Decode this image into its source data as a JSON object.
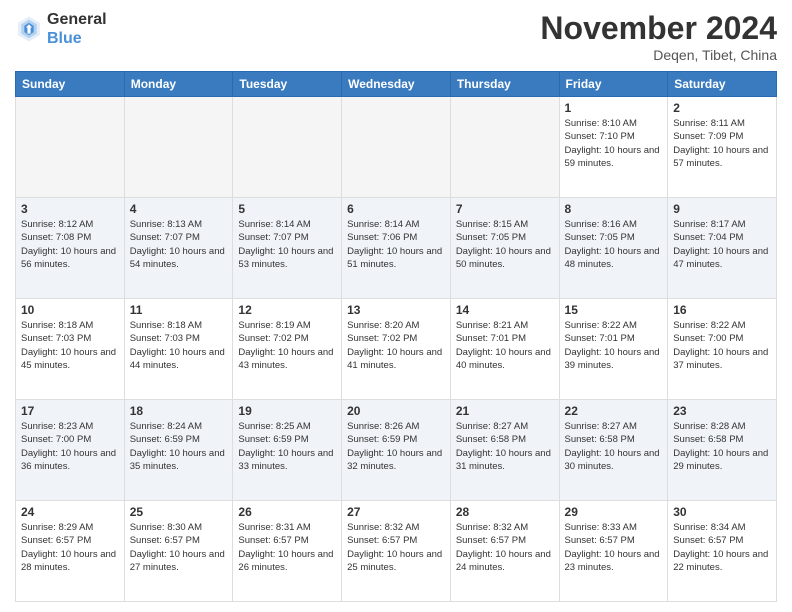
{
  "logo": {
    "line1": "General",
    "line2": "Blue"
  },
  "title": "November 2024",
  "location": "Deqen, Tibet, China",
  "weekdays": [
    "Sunday",
    "Monday",
    "Tuesday",
    "Wednesday",
    "Thursday",
    "Friday",
    "Saturday"
  ],
  "weeks": [
    [
      {
        "day": "",
        "info": ""
      },
      {
        "day": "",
        "info": ""
      },
      {
        "day": "",
        "info": ""
      },
      {
        "day": "",
        "info": ""
      },
      {
        "day": "",
        "info": ""
      },
      {
        "day": "1",
        "info": "Sunrise: 8:10 AM\nSunset: 7:10 PM\nDaylight: 10 hours and 59 minutes."
      },
      {
        "day": "2",
        "info": "Sunrise: 8:11 AM\nSunset: 7:09 PM\nDaylight: 10 hours and 57 minutes."
      }
    ],
    [
      {
        "day": "3",
        "info": "Sunrise: 8:12 AM\nSunset: 7:08 PM\nDaylight: 10 hours and 56 minutes."
      },
      {
        "day": "4",
        "info": "Sunrise: 8:13 AM\nSunset: 7:07 PM\nDaylight: 10 hours and 54 minutes."
      },
      {
        "day": "5",
        "info": "Sunrise: 8:14 AM\nSunset: 7:07 PM\nDaylight: 10 hours and 53 minutes."
      },
      {
        "day": "6",
        "info": "Sunrise: 8:14 AM\nSunset: 7:06 PM\nDaylight: 10 hours and 51 minutes."
      },
      {
        "day": "7",
        "info": "Sunrise: 8:15 AM\nSunset: 7:05 PM\nDaylight: 10 hours and 50 minutes."
      },
      {
        "day": "8",
        "info": "Sunrise: 8:16 AM\nSunset: 7:05 PM\nDaylight: 10 hours and 48 minutes."
      },
      {
        "day": "9",
        "info": "Sunrise: 8:17 AM\nSunset: 7:04 PM\nDaylight: 10 hours and 47 minutes."
      }
    ],
    [
      {
        "day": "10",
        "info": "Sunrise: 8:18 AM\nSunset: 7:03 PM\nDaylight: 10 hours and 45 minutes."
      },
      {
        "day": "11",
        "info": "Sunrise: 8:18 AM\nSunset: 7:03 PM\nDaylight: 10 hours and 44 minutes."
      },
      {
        "day": "12",
        "info": "Sunrise: 8:19 AM\nSunset: 7:02 PM\nDaylight: 10 hours and 43 minutes."
      },
      {
        "day": "13",
        "info": "Sunrise: 8:20 AM\nSunset: 7:02 PM\nDaylight: 10 hours and 41 minutes."
      },
      {
        "day": "14",
        "info": "Sunrise: 8:21 AM\nSunset: 7:01 PM\nDaylight: 10 hours and 40 minutes."
      },
      {
        "day": "15",
        "info": "Sunrise: 8:22 AM\nSunset: 7:01 PM\nDaylight: 10 hours and 39 minutes."
      },
      {
        "day": "16",
        "info": "Sunrise: 8:22 AM\nSunset: 7:00 PM\nDaylight: 10 hours and 37 minutes."
      }
    ],
    [
      {
        "day": "17",
        "info": "Sunrise: 8:23 AM\nSunset: 7:00 PM\nDaylight: 10 hours and 36 minutes."
      },
      {
        "day": "18",
        "info": "Sunrise: 8:24 AM\nSunset: 6:59 PM\nDaylight: 10 hours and 35 minutes."
      },
      {
        "day": "19",
        "info": "Sunrise: 8:25 AM\nSunset: 6:59 PM\nDaylight: 10 hours and 33 minutes."
      },
      {
        "day": "20",
        "info": "Sunrise: 8:26 AM\nSunset: 6:59 PM\nDaylight: 10 hours and 32 minutes."
      },
      {
        "day": "21",
        "info": "Sunrise: 8:27 AM\nSunset: 6:58 PM\nDaylight: 10 hours and 31 minutes."
      },
      {
        "day": "22",
        "info": "Sunrise: 8:27 AM\nSunset: 6:58 PM\nDaylight: 10 hours and 30 minutes."
      },
      {
        "day": "23",
        "info": "Sunrise: 8:28 AM\nSunset: 6:58 PM\nDaylight: 10 hours and 29 minutes."
      }
    ],
    [
      {
        "day": "24",
        "info": "Sunrise: 8:29 AM\nSunset: 6:57 PM\nDaylight: 10 hours and 28 minutes."
      },
      {
        "day": "25",
        "info": "Sunrise: 8:30 AM\nSunset: 6:57 PM\nDaylight: 10 hours and 27 minutes."
      },
      {
        "day": "26",
        "info": "Sunrise: 8:31 AM\nSunset: 6:57 PM\nDaylight: 10 hours and 26 minutes."
      },
      {
        "day": "27",
        "info": "Sunrise: 8:32 AM\nSunset: 6:57 PM\nDaylight: 10 hours and 25 minutes."
      },
      {
        "day": "28",
        "info": "Sunrise: 8:32 AM\nSunset: 6:57 PM\nDaylight: 10 hours and 24 minutes."
      },
      {
        "day": "29",
        "info": "Sunrise: 8:33 AM\nSunset: 6:57 PM\nDaylight: 10 hours and 23 minutes."
      },
      {
        "day": "30",
        "info": "Sunrise: 8:34 AM\nSunset: 6:57 PM\nDaylight: 10 hours and 22 minutes."
      }
    ]
  ]
}
